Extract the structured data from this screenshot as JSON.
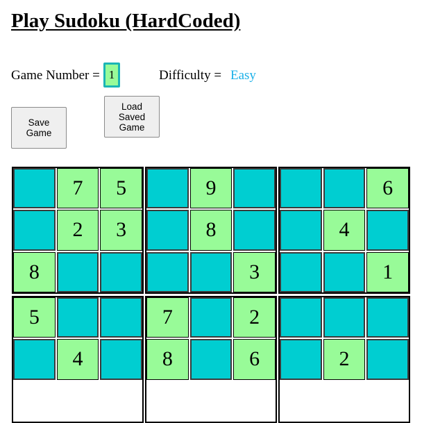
{
  "page": {
    "title": "Play Sudoku (HardCoded)"
  },
  "game": {
    "number_label": "Game Number =",
    "number_value": "1",
    "difficulty_label": "Difficulty =",
    "difficulty_value": "Easy"
  },
  "buttons": {
    "save": "Save\nGame",
    "load": "Load\nSaved\nGame"
  },
  "colors": {
    "given_cell": "#98fb98",
    "empty_cell": "#00ced1",
    "difficulty": "#1ab0e8"
  },
  "board": {
    "rows": [
      [
        "",
        "7",
        "5",
        "",
        "9",
        "",
        "",
        "",
        "6"
      ],
      [
        "",
        "2",
        "3",
        "",
        "8",
        "",
        "",
        "4",
        ""
      ],
      [
        "8",
        "",
        "",
        "",
        "",
        "3",
        "",
        "",
        "1"
      ],
      [
        "5",
        "",
        "",
        "7",
        "",
        "2",
        "",
        "",
        ""
      ],
      [
        "",
        "4",
        "",
        "8",
        "",
        "6",
        "",
        "2",
        ""
      ]
    ]
  }
}
